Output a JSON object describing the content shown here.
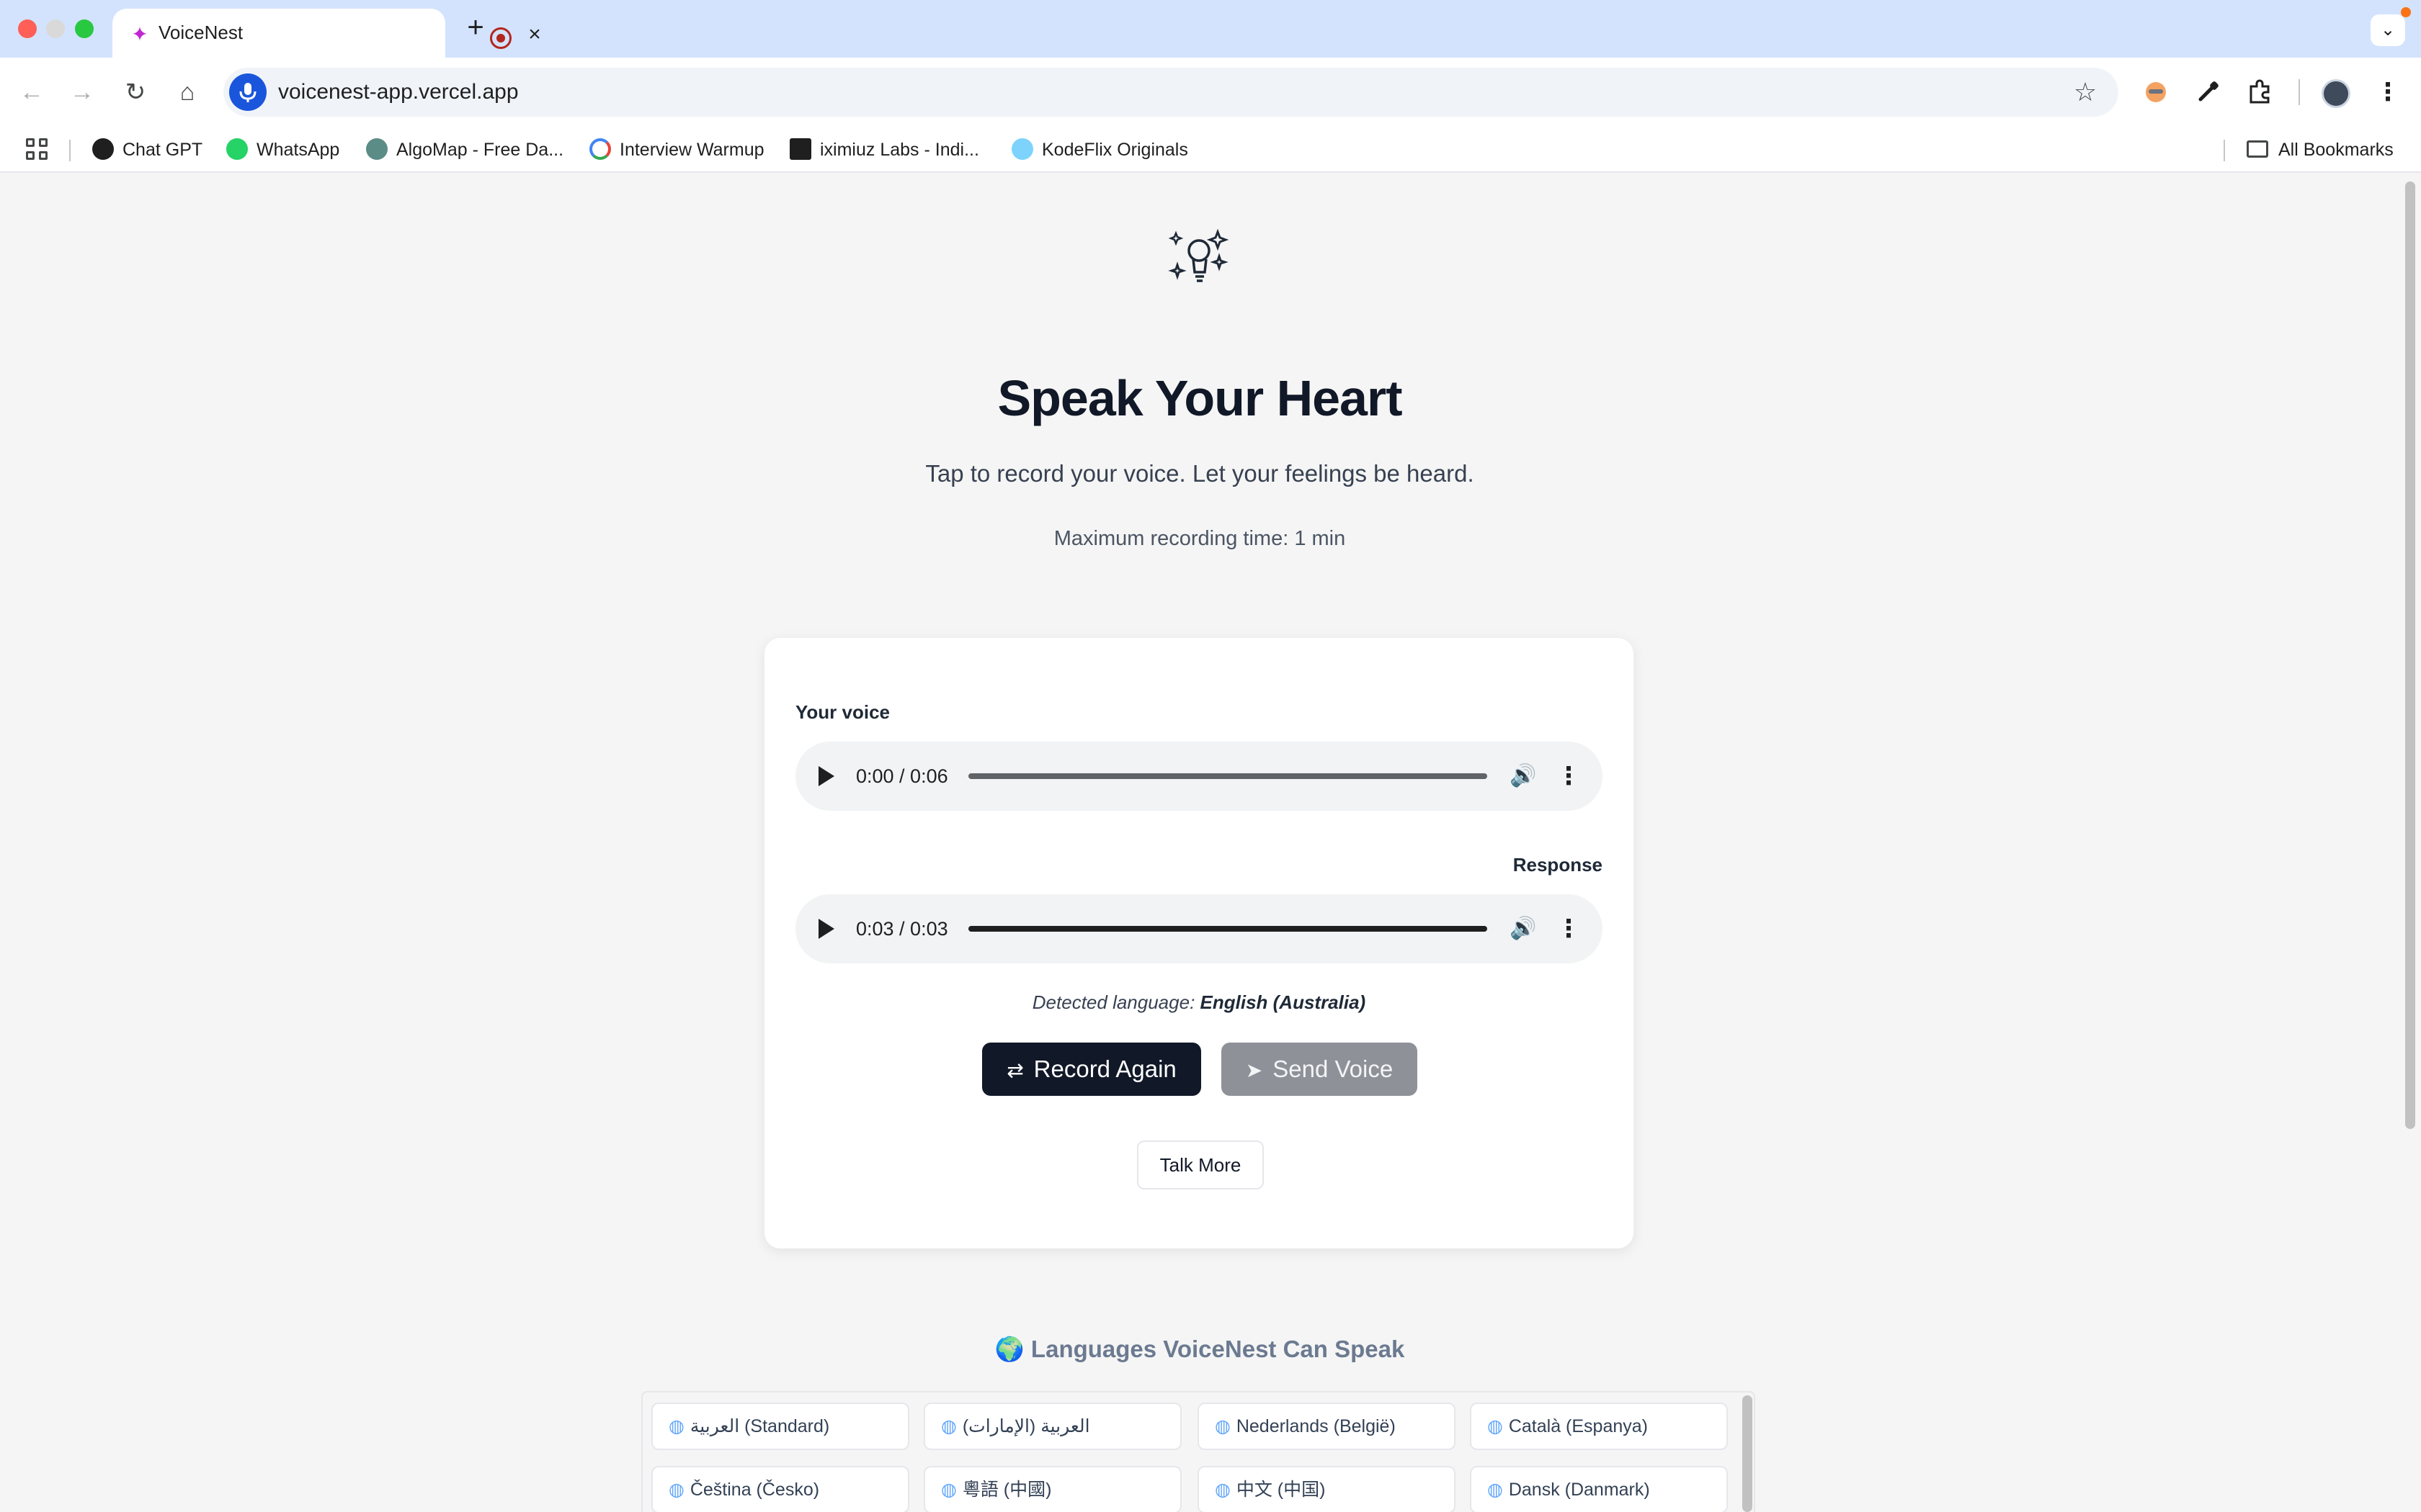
{
  "browser": {
    "tab_title": "VoiceNest",
    "tab_favicon": "sparkle-bulb-icon",
    "url": "voicenest-app.vercel.app",
    "bookmarks": [
      {
        "label": "Chat GPT",
        "icon": "chatgpt-icon"
      },
      {
        "label": "WhatsApp",
        "icon": "whatsapp-icon"
      },
      {
        "label": "AlgoMap - Free Da...",
        "icon": "algomap-icon"
      },
      {
        "label": "Interview Warmup",
        "icon": "google-icon"
      },
      {
        "label": "iximiuz Labs - Indi...",
        "icon": "iximiuz-icon"
      },
      {
        "label": "KodeFlix Originals",
        "icon": "kodeflix-icon"
      }
    ],
    "all_bookmarks": "All Bookmarks"
  },
  "hero": {
    "icon": "lightbulb-sparkle-icon",
    "title": "Speak Your Heart",
    "subtitle": "Tap to record your voice. Let your feelings be heard.",
    "max_time": "Maximum recording time: 1 min"
  },
  "card": {
    "voice_label": "Your voice",
    "voice_time": "0:00 / 0:06",
    "response_label": "Response",
    "response_time": "0:03 / 0:03",
    "detected_prefix": "Detected language: ",
    "detected_language": "English (Australia)",
    "record_again": "Record Again",
    "send_voice": "Send Voice",
    "talk_more": "Talk More"
  },
  "languages": {
    "heading": "🌍 Languages VoiceNest Can Speak",
    "items": [
      "العربية (Standard)",
      "العربية (الإمارات)",
      "Nederlands (België)",
      "Català (Espanya)",
      "Čeština (Česko)",
      "粵語 (中國)",
      "中文 (中国)",
      "Dansk (Danmark)"
    ]
  },
  "colors": {
    "primary_button": "#111827",
    "disabled_button": "#8e9198",
    "tabbar": "#d3e3fd"
  }
}
